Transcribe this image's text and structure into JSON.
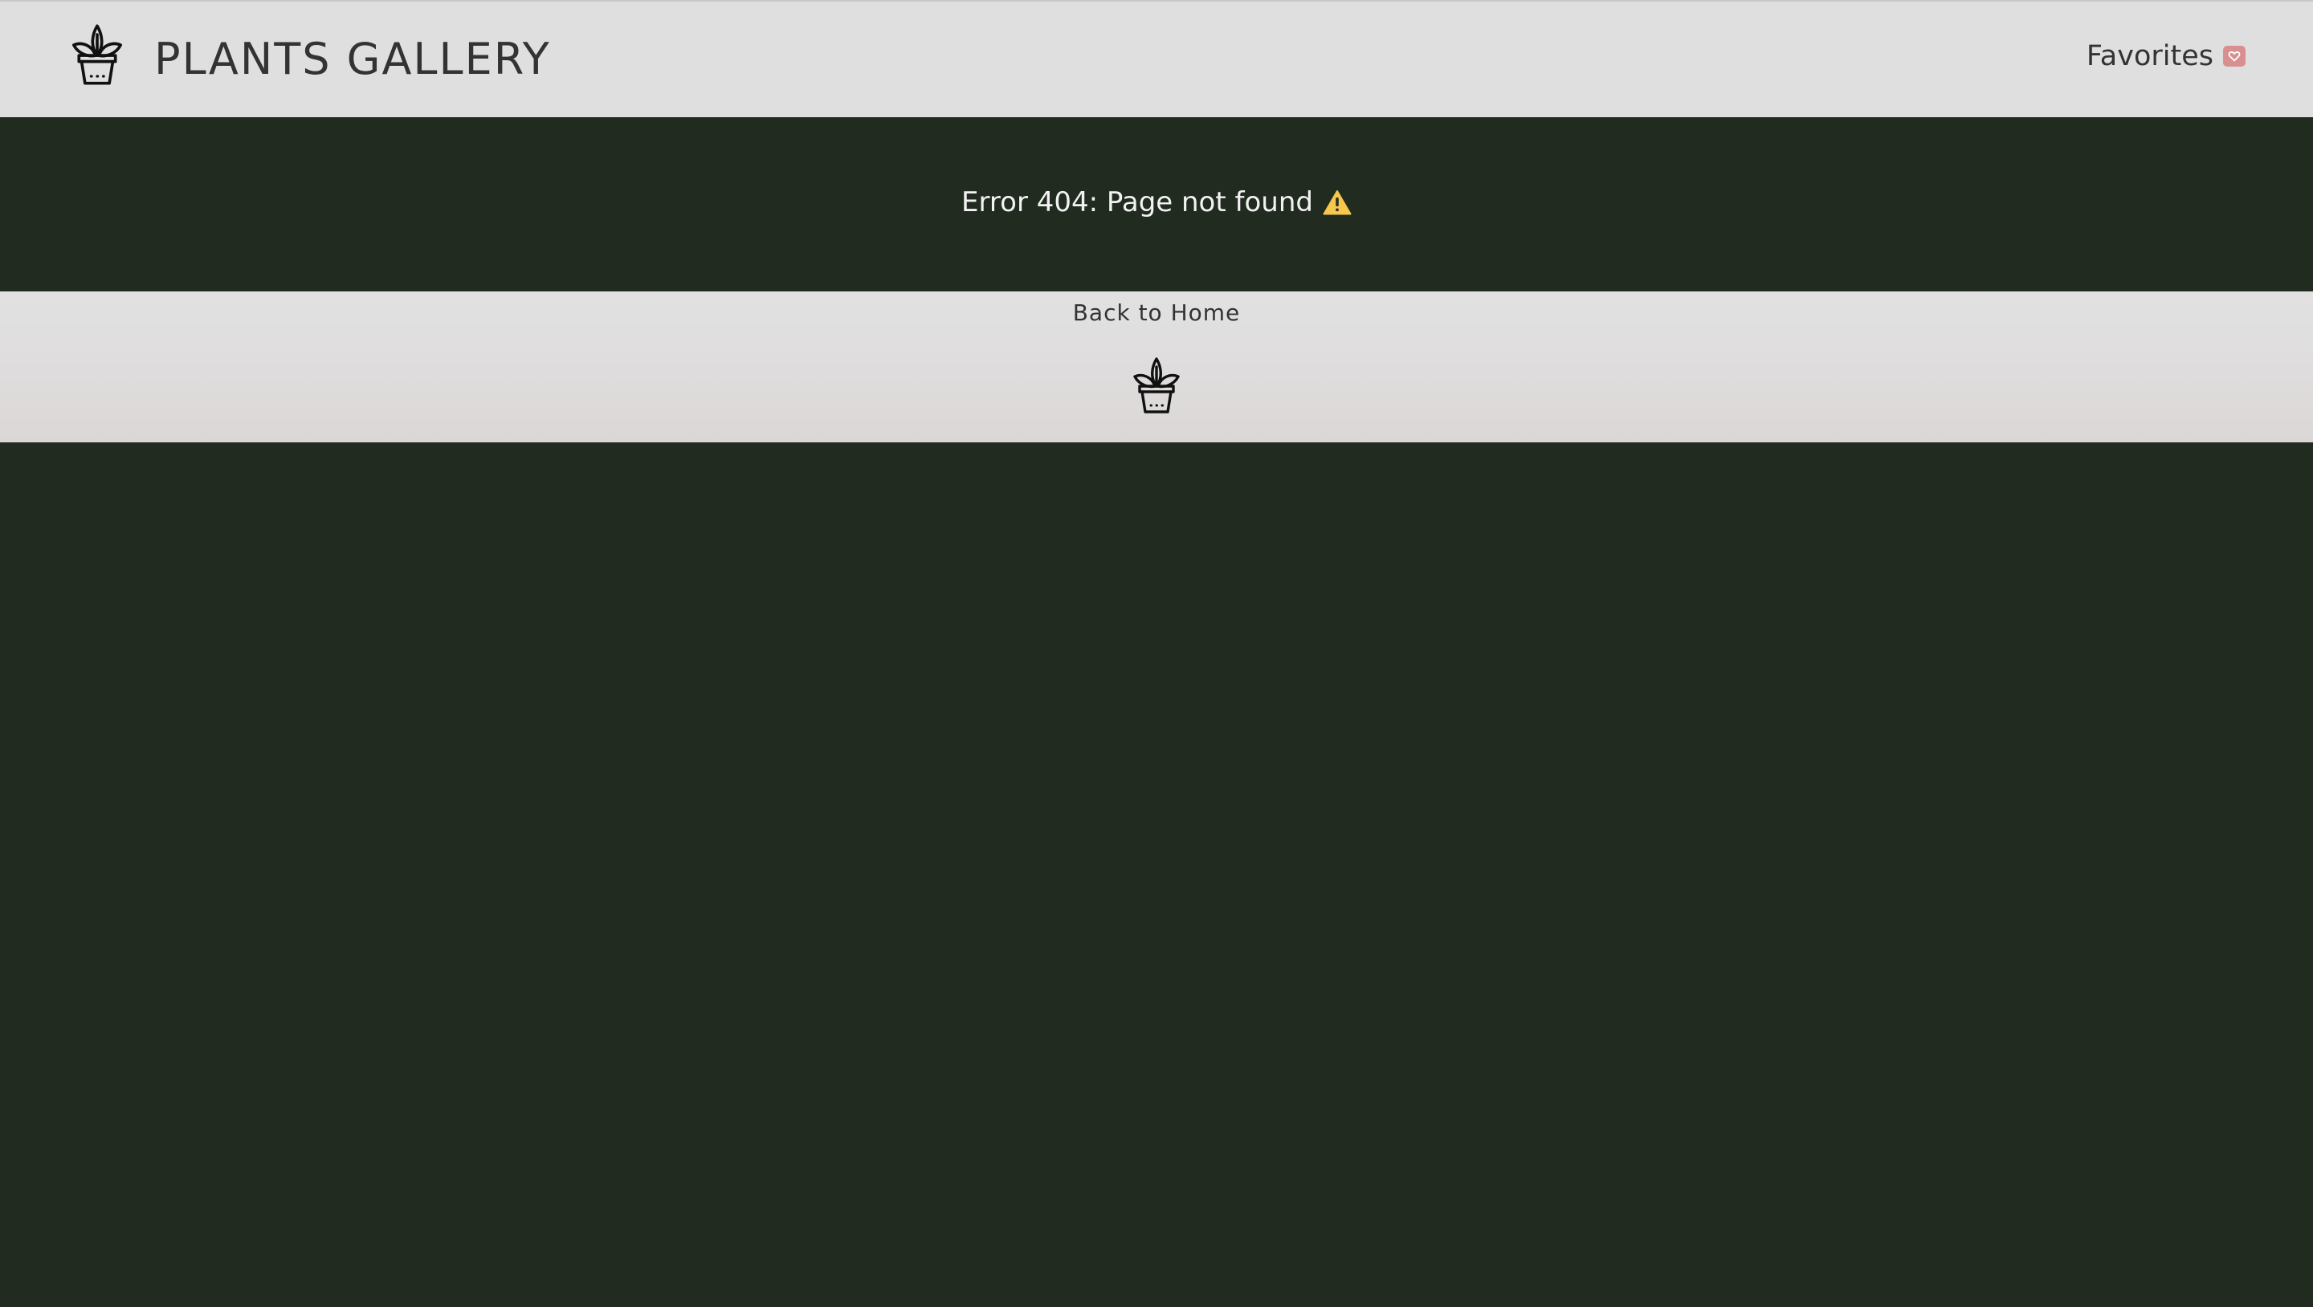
{
  "header": {
    "brand_title": "PLANTS GALLERY",
    "logo_icon": "potted-plant-icon",
    "favorites_label": "Favorites",
    "favorites_icon": "heart-icon"
  },
  "error": {
    "message": "Error 404: Page not found",
    "icon": "warning-icon"
  },
  "footer": {
    "back_link": "Back to Home",
    "logo_icon": "potted-plant-icon"
  },
  "colors": {
    "header_bg": "#e0dfdf",
    "page_bg": "#212b20",
    "text_dark": "#333333",
    "text_light": "#f2f2f2",
    "heart_badge": "#d98f8f",
    "warning": "#f5c84c"
  }
}
